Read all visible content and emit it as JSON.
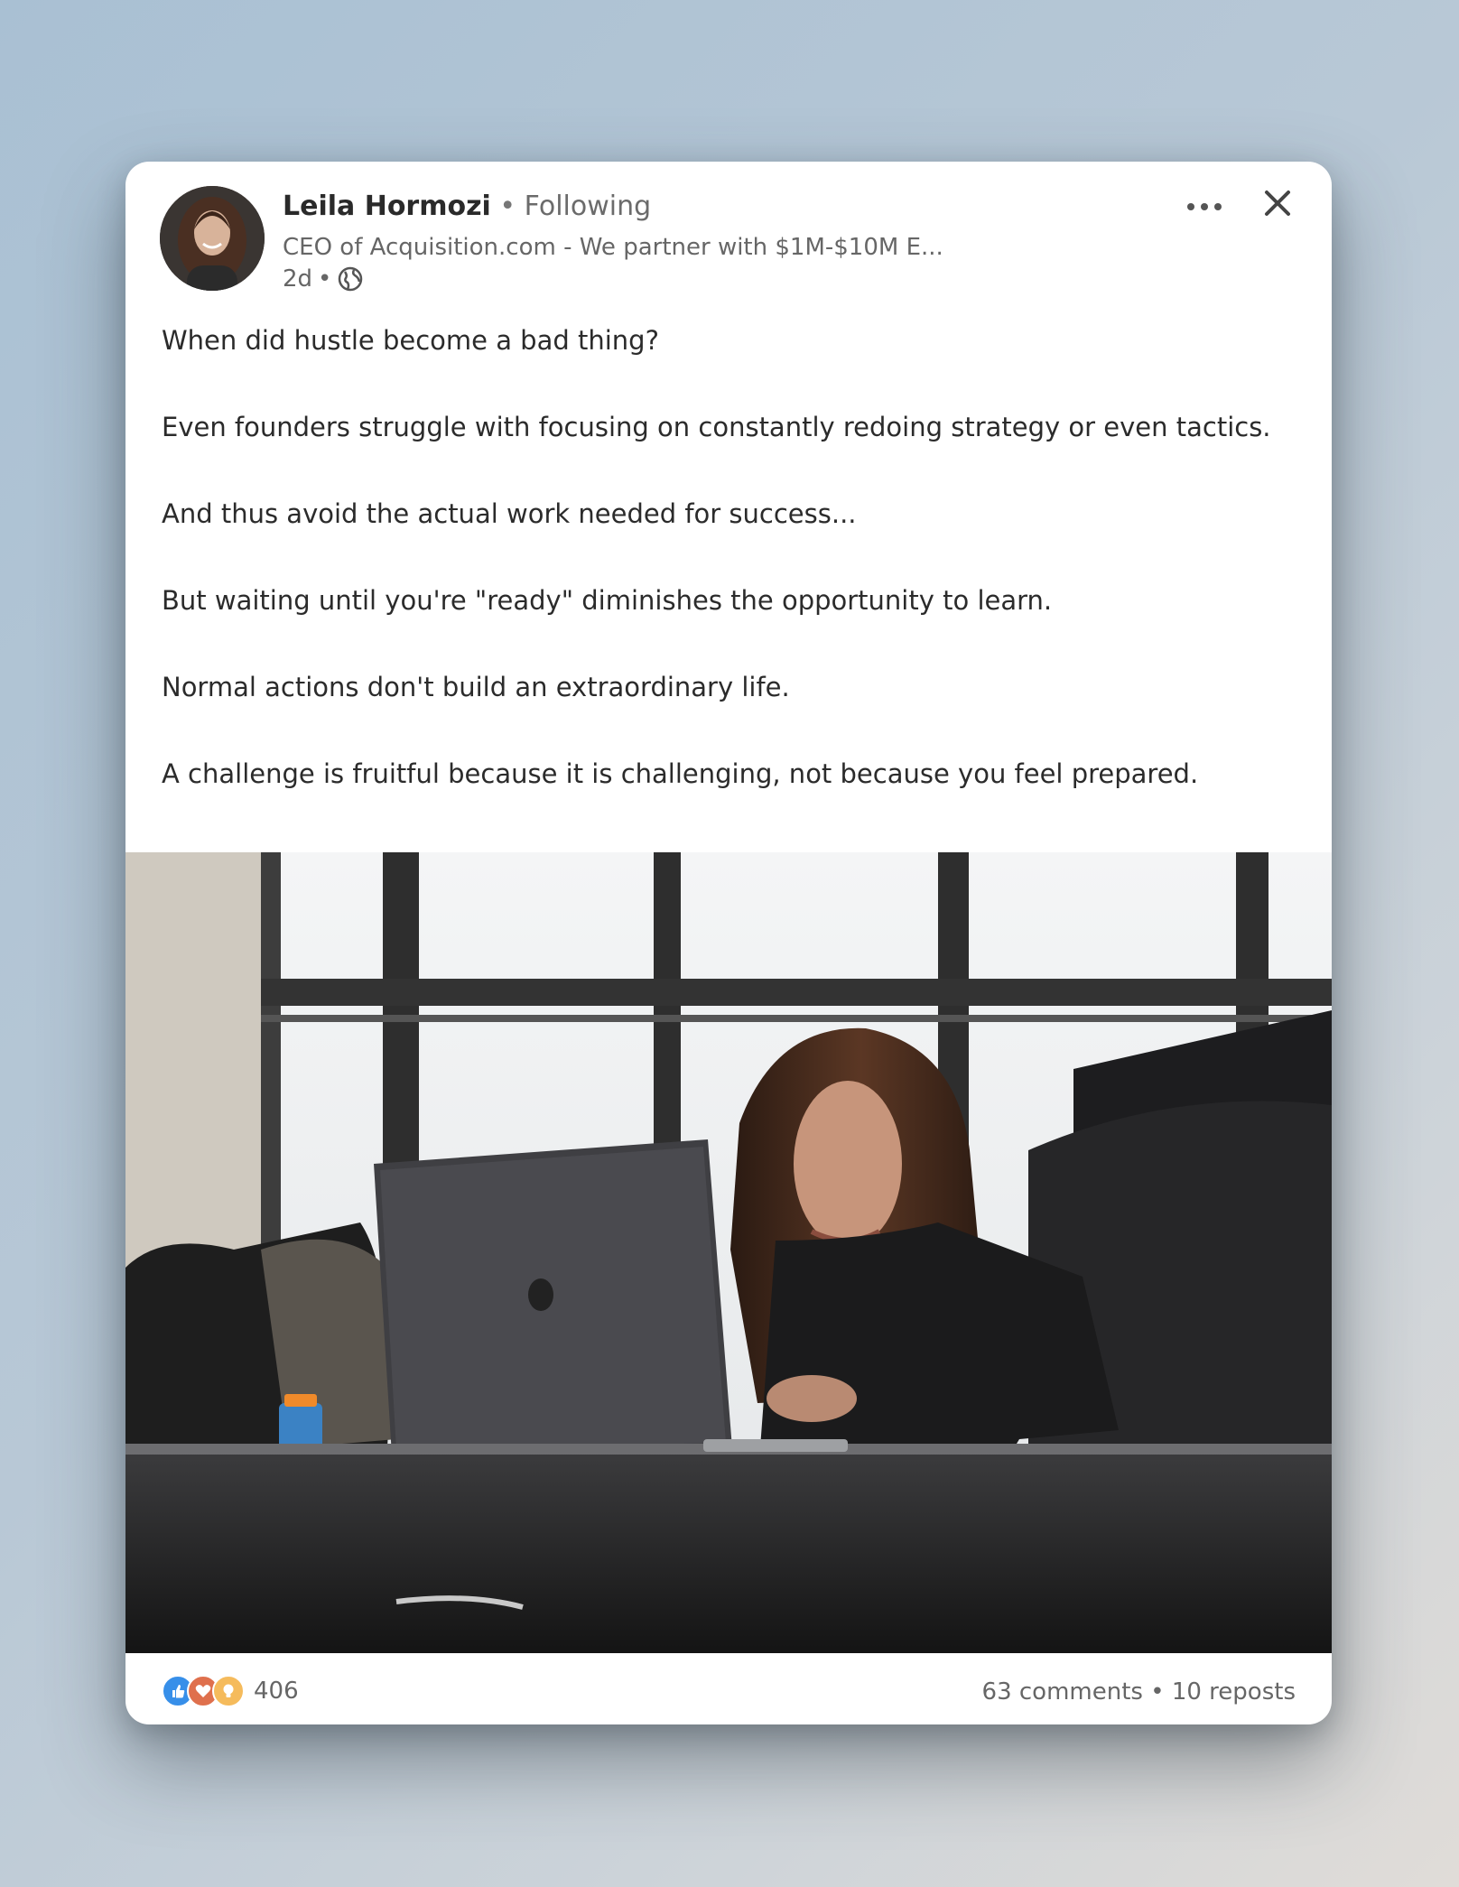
{
  "post": {
    "author": {
      "name": "Leila Hormozi",
      "follow_status": "Following",
      "separator": "•",
      "headline": "CEO of Acquisition.com - We partner with $1M-$10M E...",
      "time": "2d",
      "time_separator": "•"
    },
    "icons": {
      "more": "more-horizontal-icon",
      "close": "close-icon",
      "visibility": "globe-icon"
    },
    "text_paragraphs": [
      "When did hustle become a bad thing?",
      "Even founders struggle with focusing on constantly redoing strategy or even tactics.",
      "And thus avoid the actual work needed for success...",
      "But waiting until you're \"ready\" diminishes the opportunity to learn.",
      "Normal actions don't build an extraordinary life.",
      "A challenge is fruitful because it is challenging, not because you feel prepared."
    ],
    "social": {
      "reaction_types": [
        "like",
        "love",
        "insightful"
      ],
      "reaction_count": "406",
      "comments": "63 comments",
      "stats_separator": "•",
      "reposts": "10 reposts"
    }
  },
  "colors": {
    "like": "#378fe9",
    "love": "#df704d",
    "insightful": "#f5bb5c"
  }
}
